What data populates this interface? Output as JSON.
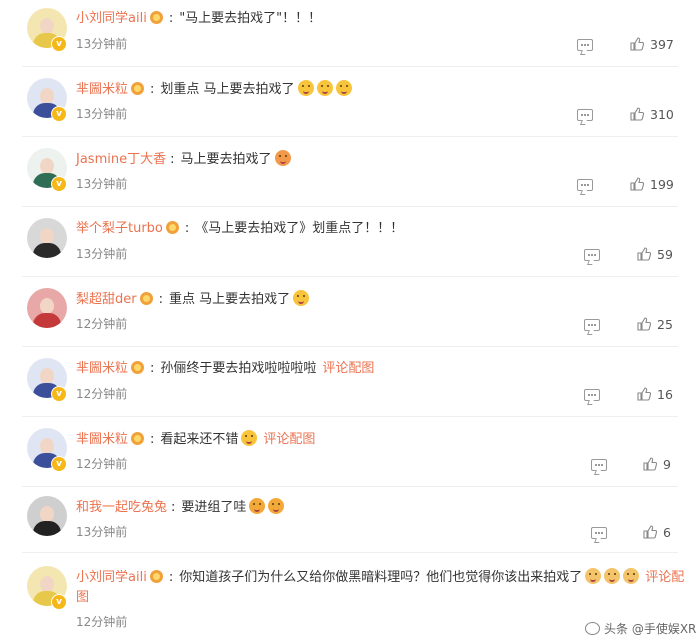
{
  "comments": [
    {
      "username": "小刘同学aili",
      "segments": [
        "\"马上要去拍戏了\"！！！"
      ],
      "emojis": [],
      "pic_link": "",
      "time": "13分钟前",
      "likes": "397",
      "avatar_color": "#e8c84a"
    },
    {
      "username": "芈圌米粒",
      "segments": [
        "划重点 马上要去拍戏了"
      ],
      "emojis": [
        "blush-emoji",
        "blush-emoji",
        "blush-emoji"
      ],
      "pic_link": "",
      "time": "13分钟前",
      "likes": "310",
      "avatar_color": "#3b4f9a"
    },
    {
      "username": "Jasmine丁大香",
      "segments": [
        "马上要去拍戏了"
      ],
      "emojis": [
        "celebrate-emoji"
      ],
      "pic_link": "",
      "time": "13分钟前",
      "likes": "199",
      "avatar_color": "#d9e4dc"
    },
    {
      "username": "举个梨子turbo",
      "segments": [
        "《马上要去拍戏了》划重点了！！！"
      ],
      "emojis": [],
      "pic_link": "",
      "time": "13分钟前",
      "likes": "59",
      "avatar_color": "#2a2a2a"
    },
    {
      "username": "梨超甜der",
      "segments": [
        "重点 马上要去拍戏了"
      ],
      "emojis": [
        "wink-emoji"
      ],
      "pic_link": "",
      "time": "12分钟前",
      "likes": "25",
      "avatar_color": "#c43a3a"
    },
    {
      "username": "芈圌米粒",
      "segments": [
        "孙俪终于要去拍戏啦啦啦啦"
      ],
      "emojis": [],
      "pic_link": "评论配图",
      "time": "12分钟前",
      "likes": "16",
      "avatar_color": "#3b4f9a"
    },
    {
      "username": "芈圌米粒",
      "segments": [
        "看起来还不错"
      ],
      "emojis": [
        "grin-emoji"
      ],
      "pic_link": "评论配图",
      "time": "12分钟前",
      "likes": "9",
      "avatar_color": "#3b4f9a"
    },
    {
      "username": "和我一起吃兔兔",
      "segments": [
        "要进组了哇"
      ],
      "emojis": [
        "laugh-emoji",
        "laugh-emoji"
      ],
      "pic_link": "",
      "time": "13分钟前",
      "likes": "6",
      "avatar_color": "#222222"
    },
    {
      "username": "小刘同学aili",
      "segments": [
        "你知道孩子们为什么又给你做黑暗料理吗？他们也觉得你该出来拍戏了"
      ],
      "emojis": [
        "dog-emoji",
        "dog-emoji",
        "dog-emoji"
      ],
      "pic_link": "评论配图",
      "time": "12分钟前",
      "likes": "",
      "avatar_color": "#e8c84a"
    }
  ],
  "watermark": "头条 @手使娱XR",
  "colors": {
    "username": "#eb7350",
    "text": "#333333",
    "time": "#888888",
    "badge": "#f6b718"
  }
}
